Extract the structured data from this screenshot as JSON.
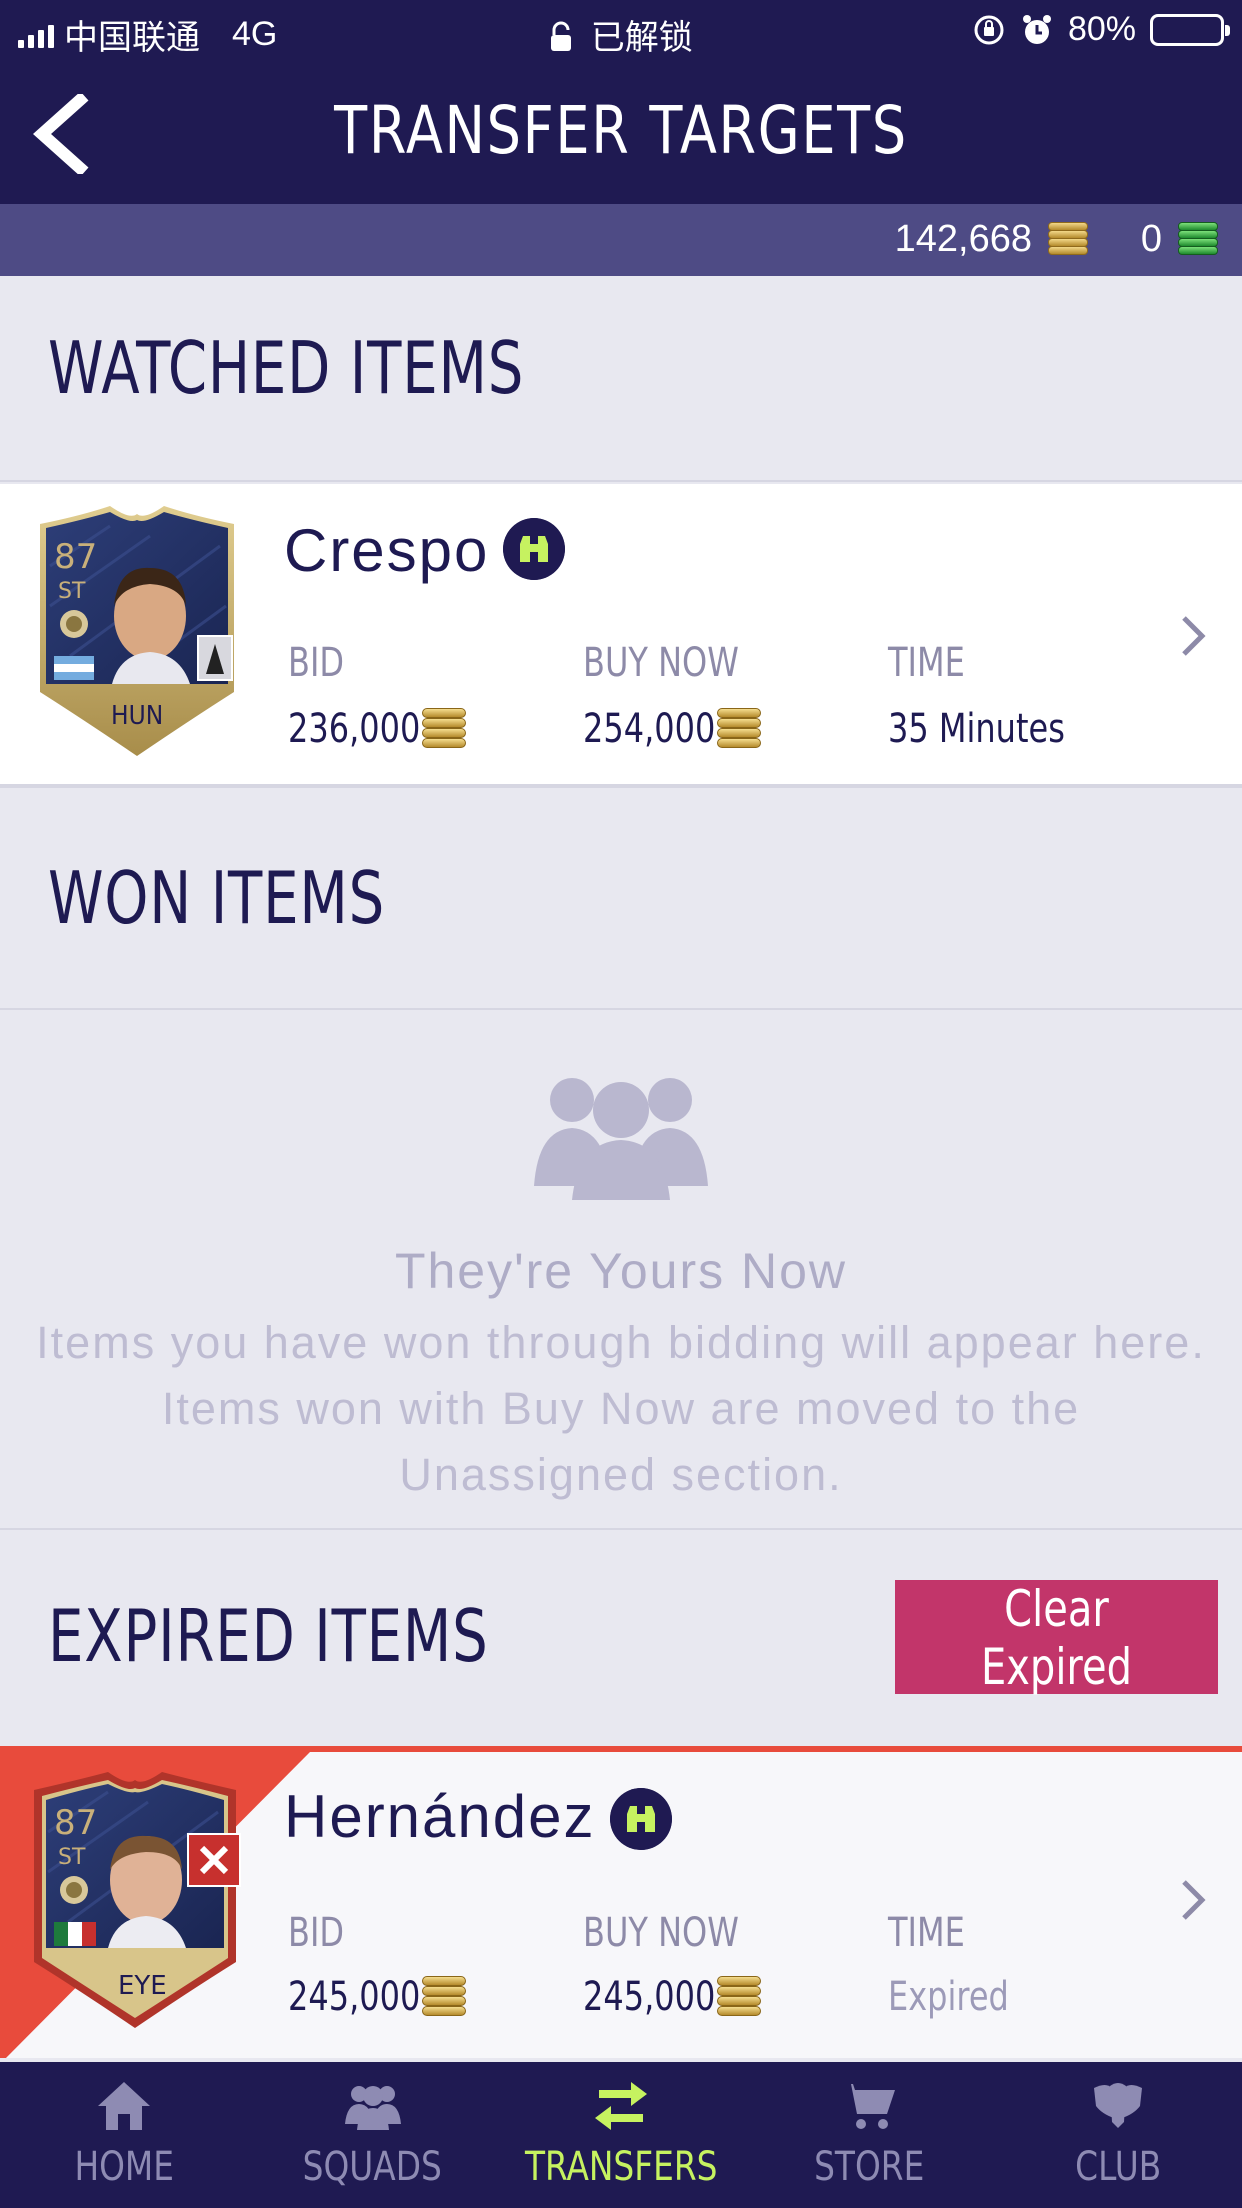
{
  "status_bar": {
    "carrier": "中国联通",
    "network": "4G",
    "center_text": "已解锁",
    "battery": "80%",
    "battery_level": 0.8
  },
  "header": {
    "title": "TRANSFER TARGETS"
  },
  "currency": {
    "coins": "142,668",
    "points": "0"
  },
  "sections": {
    "watched": {
      "title": "WATCHED ITEMS"
    },
    "won": {
      "title": "WON ITEMS",
      "empty_title": "They're Yours Now",
      "empty_body": "Items you have won through bidding will appear here. Items won with Buy Now are moved to the Unassigned section."
    },
    "expired": {
      "title": "EXPIRED ITEMS",
      "clear_button": "Clear Expired"
    }
  },
  "labels": {
    "bid": "BID",
    "buy_now": "BUY NOW",
    "time": "TIME"
  },
  "watched_items": [
    {
      "name": "Crespo",
      "rating": "87",
      "position": "ST",
      "chemistry_style": "HUN",
      "bid": "236,000",
      "buy_now": "254,000",
      "time": "35 Minutes"
    }
  ],
  "expired_items": [
    {
      "name": "Hernández",
      "rating": "87",
      "position": "ST",
      "chemistry_style": "EYE",
      "bid": "245,000",
      "buy_now": "245,000",
      "time": "Expired"
    }
  ],
  "nav": [
    {
      "label": "HOME",
      "icon": "home-icon"
    },
    {
      "label": "SQUADS",
      "icon": "squads-icon"
    },
    {
      "label": "TRANSFERS",
      "icon": "transfers-icon",
      "active": true
    },
    {
      "label": "STORE",
      "icon": "cart-icon"
    },
    {
      "label": "CLUB",
      "icon": "club-icon"
    }
  ],
  "colors": {
    "header_bg": "#1f1a52",
    "currency_bar_bg": "#4e4b85",
    "accent_active": "#c6f260",
    "clear_button": "#c2356a",
    "expired_accent": "#e84b3c"
  }
}
